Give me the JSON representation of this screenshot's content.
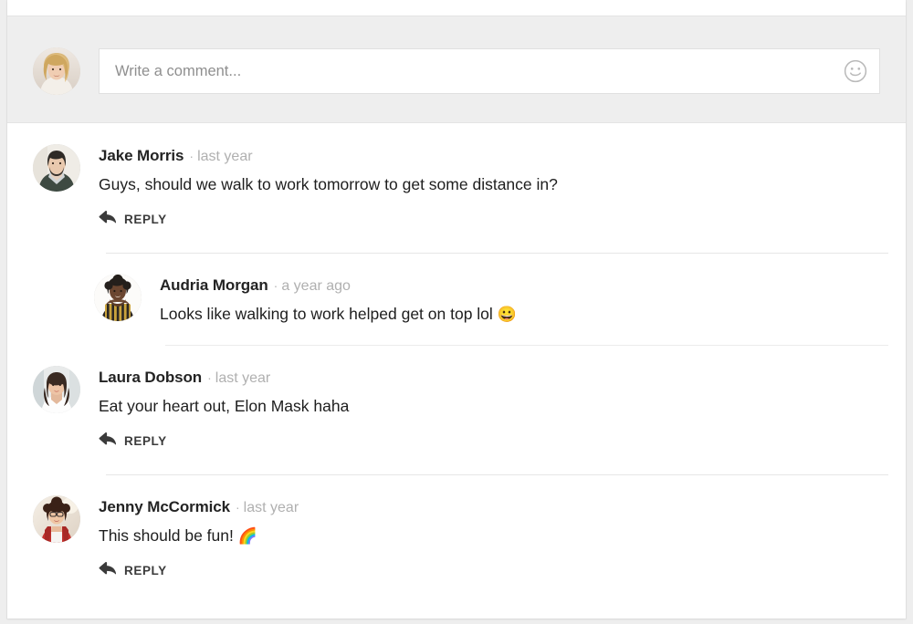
{
  "theme": {
    "page_bg": "#eeeeee",
    "card_bg": "#ffffff",
    "form_bg": "#eeeeee",
    "text_primary": "#1e1e1e",
    "text_muted": "#b0b0b0",
    "divider": "#e6e6e6"
  },
  "comment_form": {
    "placeholder": "Write a comment...",
    "value": "",
    "emoji_icon": "smiley-face-icon",
    "avatar": "current-user-avatar"
  },
  "comments": [
    {
      "id": "c1",
      "author": "Jake Morris",
      "separator": "·",
      "time": "last year",
      "text": "Guys, should we walk to work tomorrow to get some distance in?",
      "emoji": "",
      "reply_label": "REPLY",
      "reply_icon": "reply-arrow-icon",
      "has_reply": true,
      "nested": false
    },
    {
      "id": "c2",
      "author": "Audria Morgan",
      "separator": "·",
      "time": "a year ago",
      "text": "Looks like walking to work helped get on top lol ",
      "emoji": "😀",
      "reply_label": "",
      "reply_icon": "",
      "has_reply": false,
      "nested": true
    },
    {
      "id": "c3",
      "author": "Laura Dobson",
      "separator": "·",
      "time": "last year",
      "text": "Eat your heart out, Elon Mask haha",
      "emoji": "",
      "reply_label": "REPLY",
      "reply_icon": "reply-arrow-icon",
      "has_reply": true,
      "nested": false
    },
    {
      "id": "c4",
      "author": "Jenny McCormick",
      "separator": "·",
      "time": "last year",
      "text": "This should be fun! ",
      "emoji": "🌈",
      "reply_label": "REPLY",
      "reply_icon": "reply-arrow-icon",
      "has_reply": true,
      "nested": false
    }
  ]
}
